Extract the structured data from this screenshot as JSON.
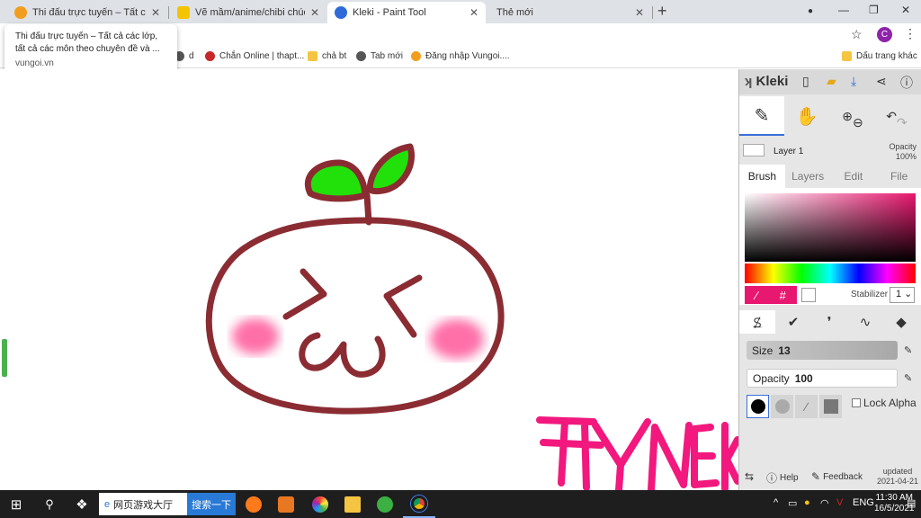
{
  "browser": {
    "tabs": [
      {
        "title": "Thi đấu trực tuyến – Tất cả các lớ",
        "color": "#f29d1e",
        "active": false
      },
      {
        "title": "Vẽ mầm/anime/chibi chúc mừng",
        "color": "#f4c400",
        "active": false
      },
      {
        "title": "Kleki - Paint Tool",
        "color": "#2f6bd8",
        "active": true
      },
      {
        "title": "Thẻ mới",
        "color": "",
        "active": false
      }
    ],
    "tab_close": "✕",
    "new_tab": "+",
    "profile_initial": "C",
    "window_controls": {
      "minimize": "—",
      "restore": "❐",
      "close": "✕"
    },
    "bookmarks": [
      {
        "label": "d",
        "icon": "globe-icon"
      },
      {
        "label": "Chắn Online | thapt...",
        "icon": "site-icon"
      },
      {
        "label": "chả bt",
        "icon": "folder-icon"
      },
      {
        "label": "Tab mới",
        "icon": "globe-icon"
      },
      {
        "label": "Đăng nhập Vungoi....",
        "icon": "site-icon"
      }
    ],
    "bookmarks_other": "Dấu trang khác",
    "tooltip": {
      "line1": "Thi đấu trực tuyến – Tất cả các lớp,",
      "line2": "tất cả các môn theo chuyên đề và ...",
      "url": "vungoi.vn"
    }
  },
  "kleki": {
    "logo": "Kleki",
    "layer": {
      "name": "Layer 1",
      "opacity_label": "Opacity",
      "opacity_value": "100%"
    },
    "subtabs": [
      "Brush",
      "Layers",
      "Edit",
      "File"
    ],
    "active_subtab": "Brush",
    "primary_color": "#e8176f",
    "picker_hash": "#",
    "stabilizer_label": "Stabilizer",
    "stabilizer_value": "1",
    "size_label": "Size",
    "size_value": "13",
    "opacity_label": "Opacity",
    "opacity_value": "100",
    "lock_alpha": "Lock Alpha",
    "help": "Help",
    "feedback": "Feedback",
    "updated_label": "updated",
    "updated_date": "2021-04-21"
  },
  "canvas": {
    "signature_text": "FFYNEKI",
    "stroke_color": "#8b2c33",
    "leaf_color": "#22e00a",
    "blush_color": "#ff6fa8",
    "signature_color": "#f2187d"
  },
  "taskbar": {
    "search_text": "网页游戏大厅",
    "search_button": "搜索一下",
    "lang": "ENG",
    "time": "11:30 AM",
    "date": "16/5/2021"
  }
}
